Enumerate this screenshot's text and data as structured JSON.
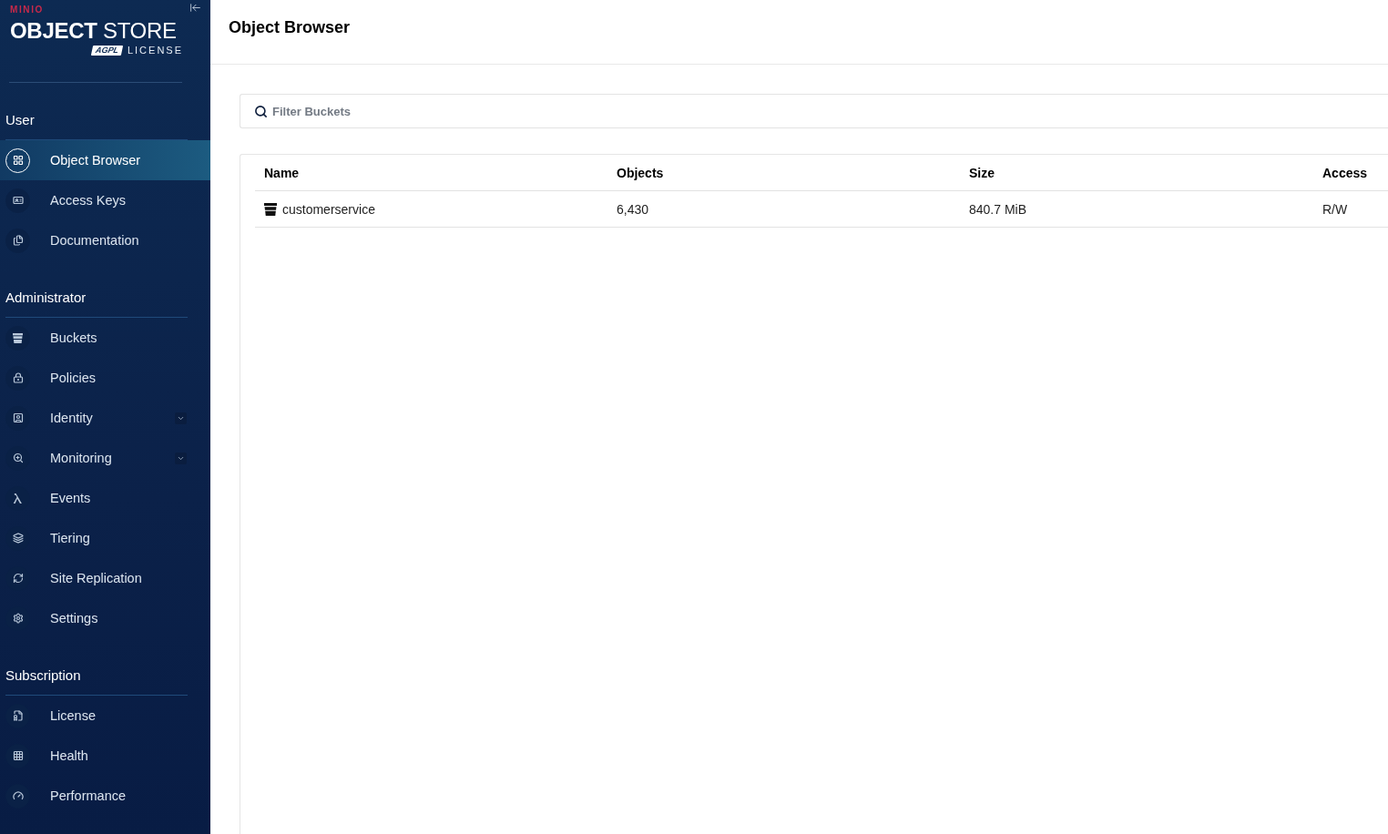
{
  "sidebar": {
    "logo": {
      "brand": "MINIO",
      "product": "**OBJECT** STORE",
      "badge": "AGPL",
      "license": "LICENSE"
    },
    "sections": [
      {
        "title": "User",
        "items": [
          {
            "label": "Object Browser",
            "kind": "link",
            "selected": true
          },
          {
            "label": "Access Keys",
            "kind": "link",
            "selected": false
          },
          {
            "label": "Documentation",
            "kind": "link",
            "selected": false
          }
        ]
      },
      {
        "title": "Administrator",
        "items": [
          {
            "label": "Buckets",
            "kind": "link",
            "selected": false
          },
          {
            "label": "Policies",
            "kind": "link",
            "selected": false
          },
          {
            "label": "Identity",
            "kind": "group",
            "expanded": false,
            "selected": false
          },
          {
            "label": "Monitoring",
            "kind": "group",
            "expanded": false,
            "selected": false
          },
          {
            "label": "Events",
            "kind": "link",
            "selected": false
          },
          {
            "label": "Tiering",
            "kind": "link",
            "selected": false
          },
          {
            "label": "Site Replication",
            "kind": "link",
            "selected": false
          },
          {
            "label": "Settings",
            "kind": "link",
            "selected": false
          }
        ]
      },
      {
        "title": "Subscription",
        "items": [
          {
            "label": "License",
            "kind": "link",
            "selected": false
          },
          {
            "label": "Health",
            "kind": "link",
            "selected": false
          },
          {
            "label": "Performance",
            "kind": "link",
            "selected": false
          }
        ]
      }
    ]
  },
  "header": {
    "title": "Object Browser"
  },
  "search": {
    "placeholder": "Filter Buckets"
  },
  "table": {
    "columns": [
      "Name",
      "Objects",
      "Size",
      "Access"
    ],
    "rows": [
      {
        "cells": [
          "customerservice",
          "6,430",
          "840.7 MiB",
          "R/W"
        ]
      }
    ]
  }
}
